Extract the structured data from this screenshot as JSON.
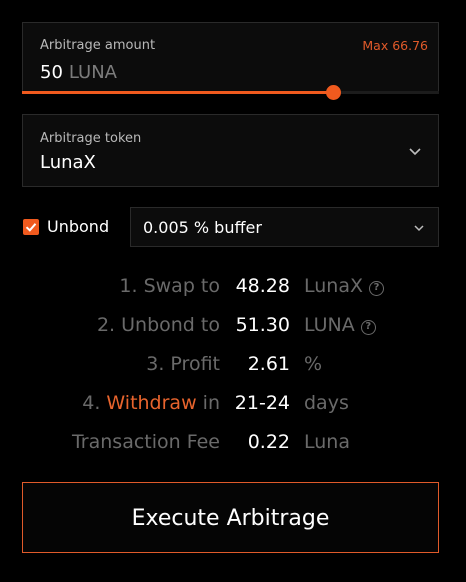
{
  "amount": {
    "label": "Arbitrage amount",
    "max_label": "Max 66.76",
    "value": "50",
    "unit": "LUNA",
    "slider_fraction": 0.749
  },
  "token": {
    "label": "Arbitrage token",
    "value": "LunaX"
  },
  "unbond": {
    "checked": true,
    "label": "Unbond",
    "buffer_value": "0.005 % buffer"
  },
  "steps": [
    {
      "prefix": "1. Swap to",
      "value": "48.28",
      "unit": "LunaX",
      "help": true
    },
    {
      "prefix": "2. Unbond to",
      "value": "51.30",
      "unit": "LUNA",
      "help": true
    },
    {
      "prefix": "3. Profit",
      "value": "2.61",
      "unit": "%",
      "help": false
    },
    {
      "prefix": "4.",
      "highlight": "Withdraw",
      "suffix": "in",
      "value": "21-24",
      "unit": "days",
      "help": false
    },
    {
      "prefix": "Transaction Fee",
      "value": "0.22",
      "unit": "Luna",
      "help": false
    }
  ],
  "help_icon_glyph": "?",
  "execute_label": "Execute Arbitrage",
  "colors": {
    "accent": "#f05a1e",
    "muted": "#6a6a6a",
    "background": "#000000"
  }
}
